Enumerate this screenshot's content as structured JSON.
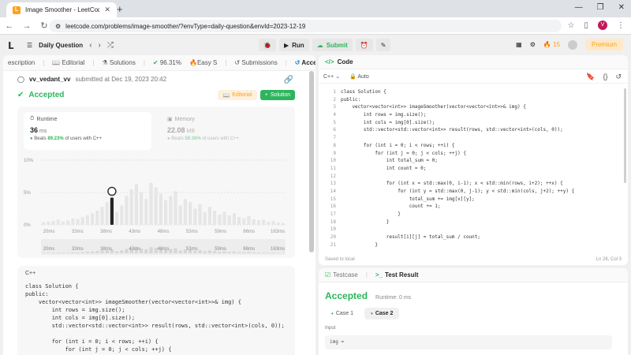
{
  "browser": {
    "tab_title": "Image Smoother - LeetCode",
    "url": "leetcode.com/problems/image-smoother/?envType=daily-question&envId=2023-12-19"
  },
  "nav": {
    "daily_question": "Daily Question",
    "run": "Run",
    "submit": "Submit",
    "streak": "15",
    "premium": "Premium"
  },
  "left_tabs": [
    {
      "label": "escription"
    },
    {
      "label": "Editorial"
    },
    {
      "label": "Solutions"
    },
    {
      "label": "96.31%"
    },
    {
      "label": "Easy"
    },
    {
      "label": "S"
    },
    {
      "label": "Submissions"
    },
    {
      "label": "Accepted"
    }
  ],
  "submission": {
    "user": "vv_vedant_vv",
    "meta": "submitted at Dec 19, 2023 20:42",
    "status": "Accepted",
    "editorial_btn": "Editorial",
    "solution_btn": "Solution"
  },
  "runtime": {
    "label": "Runtime",
    "value": "36",
    "unit": "ms",
    "beats_prefix": "Beats",
    "beats_pct": "89.23%",
    "beats_suffix": "of users with C++"
  },
  "memory": {
    "label": "Memory",
    "value": "22.08",
    "unit": "MB",
    "beats_prefix": "Beats",
    "beats_pct": "59.38%",
    "beats_suffix": "of users with C++"
  },
  "chart_data": {
    "type": "bar",
    "y_ticks": [
      "10%",
      "5%",
      "0%"
    ],
    "ylim": [
      0,
      10
    ],
    "x_ticks": [
      "20ms",
      "33ms",
      "38ms",
      "43ms",
      "48ms",
      "53ms",
      "59ms",
      "66ms",
      "163ms"
    ],
    "values": [
      0.4,
      0.5,
      0.6,
      0.8,
      0.5,
      0.7,
      1.0,
      0.9,
      1.2,
      1.5,
      1.8,
      2.2,
      2.8,
      3.5,
      4.2,
      2.0,
      3.0,
      4.5,
      5.5,
      6.3,
      5.0,
      4.0,
      6.5,
      5.8,
      4.8,
      3.8,
      4.5,
      5.2,
      3.0,
      4.0,
      3.5,
      2.5,
      3.2,
      2.0,
      2.8,
      2.2,
      1.6,
      2.0,
      1.5,
      1.8,
      1.2,
      1.0,
      1.4,
      0.9,
      0.7,
      0.8,
      0.5,
      0.6,
      0.4,
      0.3
    ],
    "highlight_index": 14
  },
  "left_code": {
    "lang": "C++",
    "lines": [
      "class Solution {",
      "public:",
      "    vector<vector<int>> imageSmoother(vector<vector<int>>& img) {",
      "        int rows = img.size();",
      "        int cols = img[0].size();",
      "        std::vector<std::vector<int>> result(rows, std::vector<int>(cols, 0));",
      "",
      "        for (int i = 0; i < rows; ++i) {",
      "            for (int j = 0; j < cols; ++j) {"
    ]
  },
  "editor": {
    "title": "Code",
    "lang": "C++",
    "mode": "Auto",
    "status_left": "Saved to local",
    "status_right": "Ln 26, Col 3",
    "line_numbers": [
      "1",
      "2",
      "3",
      "4",
      "5",
      "6",
      "7",
      "8",
      "9",
      "10",
      "11",
      "12",
      "13",
      "14",
      "15",
      "16",
      "17",
      "18",
      "19",
      "20",
      "21"
    ],
    "lines": [
      "class Solution {",
      "public:",
      "    vector<vector<int>> imageSmoother(vector<vector<int>>& img) {",
      "        int rows = img.size();",
      "        int cols = img[0].size();",
      "        std::vector<std::vector<int>> result(rows, std::vector<int>(cols, 0));",
      "",
      "        for (int i = 0; i < rows; ++i) {",
      "            for (int j = 0; j < cols; ++j) {",
      "                int total_sum = 0;",
      "                int count = 0;",
      "",
      "                for (int x = std::max(0, i-1); x < std::min(rows, i+2); ++x) {",
      "                    for (int y = std::max(0, j-1); y < std::min(cols, j+2); ++y) {",
      "                        total_sum += img[x][y];",
      "                        count += 1;",
      "                    }",
      "                }",
      "",
      "                result[i][j] = total_sum / count;",
      "            }",
      "        }"
    ]
  },
  "test": {
    "tab_testcase": "Testcase",
    "tab_result": "Test Result",
    "status": "Accepted",
    "runtime": "Runtime: 0 ms",
    "case1": "Case 1",
    "case2": "Case 2",
    "input_label": "Input",
    "input_value": "img ="
  }
}
